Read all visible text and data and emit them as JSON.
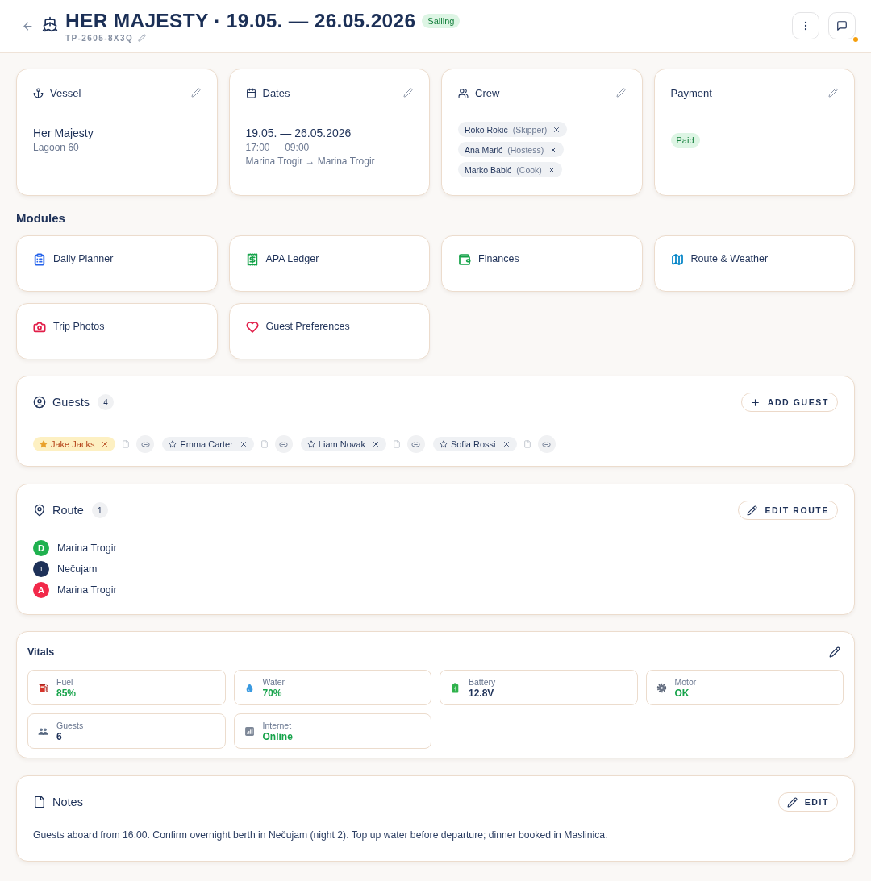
{
  "header": {
    "title": "HER MAJESTY · 19.05. — 26.05.2026",
    "status": "Sailing",
    "code": "TP-2605-8X3Q",
    "has_notification": true
  },
  "summary_cards": [
    {
      "kind": "vessel",
      "label": "Vessel",
      "title": "Her Majesty",
      "lines": [
        "Lagoon 60"
      ]
    },
    {
      "kind": "dates",
      "label": "Dates",
      "title": "19.05. — 26.05.2026",
      "lines": [
        "17:00 — 09:00",
        "Marina Trogir → Marina Trogir"
      ]
    },
    {
      "kind": "crew",
      "label": "Crew",
      "crew": [
        {
          "name": "Roko Rokić",
          "role": "(Skipper)"
        },
        {
          "name": "Ana Marić",
          "role": "(Hostess)"
        },
        {
          "name": "Marko Babić",
          "role": "(Cook)"
        }
      ]
    },
    {
      "kind": "payment",
      "label": "Payment",
      "badge": "Paid"
    }
  ],
  "modules": {
    "title": "Modules",
    "items": [
      {
        "kind": "planner",
        "label": "Daily Planner",
        "color": "#2563eb"
      },
      {
        "kind": "ledger",
        "label": "APA Ledger",
        "color": "#16a34a"
      },
      {
        "kind": "finances",
        "label": "Finances",
        "color": "#16a34a"
      },
      {
        "kind": "route",
        "label": "Route & Weather",
        "color": "#0284c7"
      },
      {
        "kind": "photos",
        "label": "Trip Photos",
        "color": "#e11d48"
      },
      {
        "kind": "preferences",
        "label": "Guest Preferences",
        "color": "#e11d48"
      }
    ]
  },
  "guests": {
    "title": "Guests",
    "count": "4",
    "button": "ADD GUEST",
    "items": [
      {
        "name": "Jake Jacks",
        "starred": true
      },
      {
        "name": "Emma Carter",
        "starred": false
      },
      {
        "name": "Liam Novak",
        "starred": false
      },
      {
        "name": "Sofia Rossi",
        "starred": false
      }
    ]
  },
  "route": {
    "title": "Route",
    "count": "1",
    "button": "EDIT ROUTE",
    "stops": [
      {
        "marker": "D",
        "name": "Marina Trogir",
        "color": "#1fb14f"
      },
      {
        "marker": "1",
        "name": "Nečujam",
        "color": "#1e3158"
      },
      {
        "marker": "A",
        "name": "Marina Trogir",
        "color": "#f2294a"
      }
    ]
  },
  "vitals": {
    "title": "Vitals",
    "items": [
      {
        "kind": "fuel",
        "label": "Fuel",
        "value": "85%",
        "positive": true
      },
      {
        "kind": "water",
        "label": "Water",
        "value": "70%",
        "positive": true
      },
      {
        "kind": "battery",
        "label": "Battery",
        "value": "12.8V",
        "positive": false
      },
      {
        "kind": "motor",
        "label": "Motor",
        "value": "OK",
        "positive": true
      },
      {
        "kind": "guests",
        "label": "Guests",
        "value": "6",
        "positive": false
      },
      {
        "kind": "internet",
        "label": "Internet",
        "value": "Online",
        "positive": true
      }
    ]
  },
  "notes": {
    "title": "Notes",
    "button": "EDIT",
    "text": "Guests aboard from 16:00. Confirm overnight berth in Nečujam (night 2). Top up water before departure; dinner booked in Maslinica."
  }
}
